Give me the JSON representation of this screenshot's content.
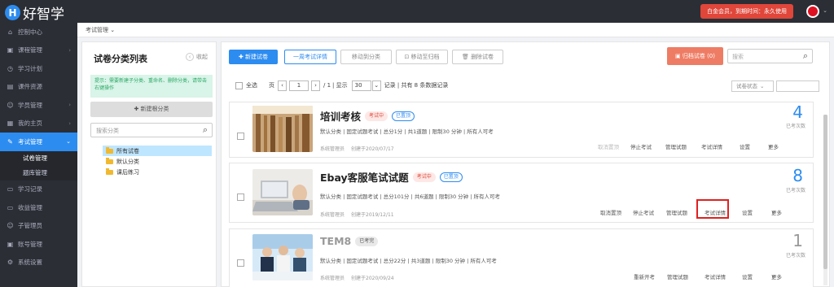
{
  "app": {
    "logo_letter": "H",
    "logo_text": "好智学",
    "vip_badge": "白金会员，到期时间：永久使用"
  },
  "sidebar": {
    "items": [
      {
        "label": "控制中心",
        "icon": "home-icon"
      },
      {
        "label": "课程管理",
        "icon": "course-icon"
      },
      {
        "label": "学习计划",
        "icon": "plan-icon"
      },
      {
        "label": "课件资源",
        "icon": "file-icon"
      },
      {
        "label": "学员管理",
        "icon": "user-icon"
      },
      {
        "label": "我的主页",
        "icon": "homepage-icon"
      },
      {
        "label": "考试管理",
        "icon": "exam-icon",
        "active": true
      }
    ],
    "sub_items": [
      {
        "label": "试卷管理",
        "active": true
      },
      {
        "label": "题库管理"
      }
    ],
    "items_after": [
      {
        "label": "学习记录",
        "icon": "record-icon"
      },
      {
        "label": "收益管理",
        "icon": "income-icon"
      },
      {
        "label": "子管理员",
        "icon": "admin-icon"
      },
      {
        "label": "账号管理",
        "icon": "account-icon"
      },
      {
        "label": "系统设置",
        "icon": "settings-icon"
      }
    ]
  },
  "breadcrumb": "考试管理",
  "left_panel": {
    "title": "试卷分类列表",
    "collapse_label": "收起",
    "tip": "提示：需要新建子分类、重命名、删除分类，请带击右键操作",
    "new_category": "新建根分类",
    "search_placeholder": "搜索分类",
    "tree": [
      {
        "label": "所有试卷",
        "selected": true
      },
      {
        "label": "默认分类"
      },
      {
        "label": "课后练习"
      }
    ]
  },
  "toolbar": {
    "new_exam": "新建试卷",
    "weekly_detail": "一周考试详情",
    "move_category": "移动到分类",
    "move_archive": "移动至归档",
    "delete_exam": "删除试卷",
    "archive": "归档试卷 (0)",
    "search_placeholder": "搜索"
  },
  "pager": {
    "select_all": "全选",
    "page_label": "页",
    "current_page": "1",
    "total_pages": "/ 1",
    "show_label": "| 显示",
    "page_size": "30",
    "records": "记录 | 共有 8 条数据记录",
    "status_filter": "试卷状态"
  },
  "cards": [
    {
      "title": "培训考核",
      "status": "考试中",
      "pinned": "已置顶",
      "meta": "默认分类 | 固定试题考试 | 总分1分 | 共1道题 | 限制30 分钟 | 所有人可考",
      "creator": "系统管理员",
      "created": "创建于2020/07/17",
      "count": "4",
      "count_label": "已考次数",
      "actions": [
        "取消置顶",
        "停止考试",
        "管理试题",
        "考试详情",
        "设置",
        "更多"
      ]
    },
    {
      "title": "Ebay客服笔试试题",
      "status": "考试中",
      "pinned": "已置顶",
      "meta": "默认分类 | 固定试题考试 | 总分101分 | 共6道题 | 限制30 分钟 | 所有人可考",
      "creator": "系统管理员",
      "created": "创建于2019/12/11",
      "count": "8",
      "count_label": "已考次数",
      "actions": [
        "取消置顶",
        "停止考试",
        "管理试题",
        "考试详情",
        "设置",
        "更多"
      ]
    },
    {
      "title": "TEM8",
      "status": "已考完",
      "meta": "默认分类 | 固定试题考试 | 总分22分 | 共3道题 | 限制30 分钟 | 所有人可考",
      "creator": "系统管理员",
      "created": "创建于2020/09/24",
      "count": "1",
      "count_label": "已考次数",
      "actions": [
        "重新开考",
        "管理试题",
        "考试详情",
        "设置",
        "更多"
      ]
    }
  ]
}
